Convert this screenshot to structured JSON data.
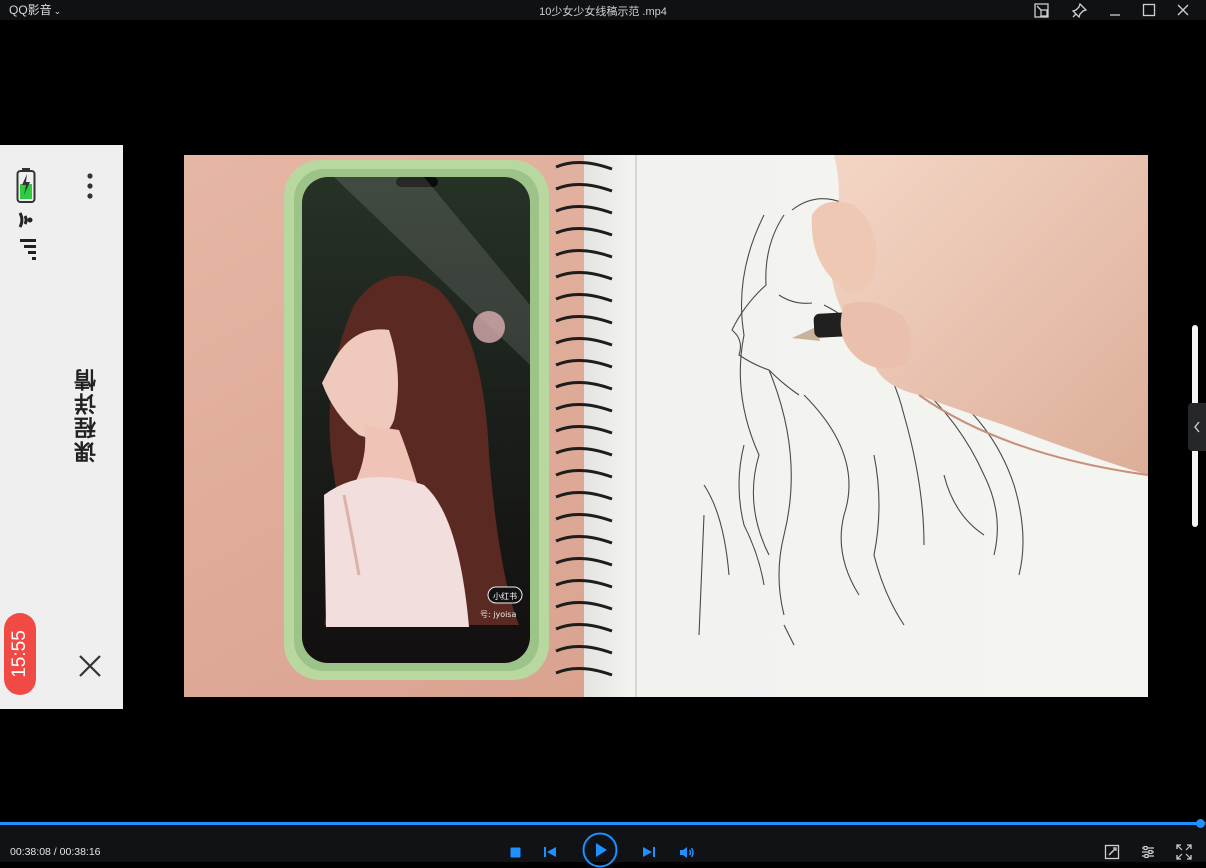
{
  "titlebar": {
    "app_name": "QQ影音",
    "file_title": "10少女少女线稿示范 .mp4"
  },
  "side_panel": {
    "title": "课程详情",
    "clock": "15:55"
  },
  "overlay": {
    "badge": "小红书",
    "credit": "号: jyoisa"
  },
  "player": {
    "current_time": "00:38:08",
    "separator": " / ",
    "total_time": "00:38:16",
    "progress": 0.9965
  },
  "colors": {
    "accent": "#1e90ff",
    "clock_badge": "#f14a45",
    "panel_bg": "#efefef"
  },
  "icons": {
    "window": [
      "mini-mode-icon",
      "pin-icon",
      "minimize-icon",
      "maximize-icon",
      "close-icon"
    ],
    "playback": [
      "stop-icon",
      "previous-icon",
      "play-icon",
      "next-icon",
      "volume-icon"
    ],
    "tools": [
      "screenshot-tool-icon",
      "equalizer-icon",
      "fullscreen-icon"
    ]
  }
}
